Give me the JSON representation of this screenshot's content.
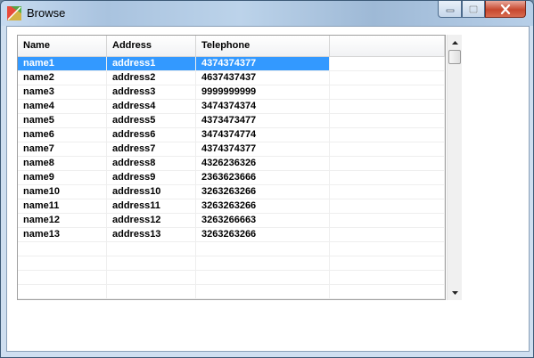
{
  "window": {
    "title": "Browse"
  },
  "table": {
    "columns": [
      "Name",
      "Address",
      "Telephone"
    ],
    "rows": [
      [
        "name1",
        "address1",
        "4374374377"
      ],
      [
        "name2",
        "address2",
        "4637437437"
      ],
      [
        "name3",
        "address3",
        "9999999999"
      ],
      [
        "name4",
        "address4",
        "3474374374"
      ],
      [
        "name5",
        "address5",
        "4373473477"
      ],
      [
        "name6",
        "address6",
        "3474374774"
      ],
      [
        "name7",
        "address7",
        "4374374377"
      ],
      [
        "name8",
        "address8",
        "4326236326"
      ],
      [
        "name9",
        "address9",
        "2363623666"
      ],
      [
        "name10",
        "address10",
        "3263263266"
      ],
      [
        "name11",
        "address11",
        "3263263266"
      ],
      [
        "name12",
        "address12",
        "3263266663"
      ],
      [
        "name13",
        "address13",
        "3263263266"
      ]
    ],
    "selected_row": 0,
    "empty_rows": 4
  },
  "icons": {
    "app": "app-logo-icon",
    "minimize": "minimize-icon",
    "maximize": "maximize-icon",
    "close": "close-icon",
    "scroll_up": "scroll-up-icon",
    "scroll_down": "scroll-down-icon"
  },
  "colors": {
    "selection": "#3399ff",
    "close_button": "#c7482f"
  }
}
